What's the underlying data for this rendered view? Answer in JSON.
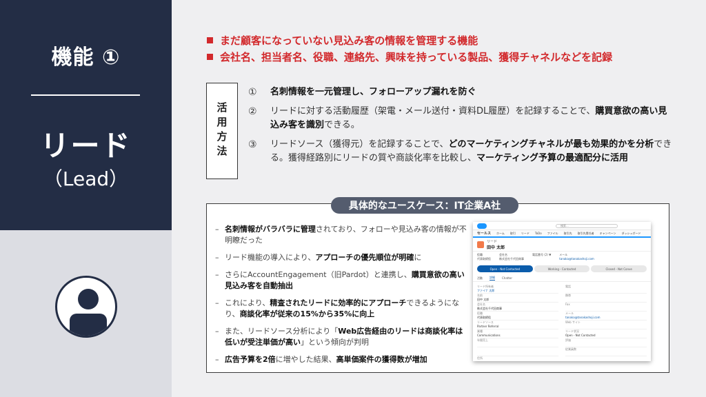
{
  "left": {
    "feature_label": "機能 ①",
    "title_jp": "リード",
    "title_en": "（Lead）"
  },
  "bullets": [
    "まだ顧客になっていない見込み客の情報を管理する機能",
    "会社名、担当者名、役職、連絡先、興味を持っている製品、獲得チャネルなどを記録"
  ],
  "usage": {
    "label": "活用方法",
    "items": [
      {
        "num": "①",
        "parts": [
          {
            "b": "名刺情報を一元管理し、フォローアップ漏れを防ぐ"
          }
        ]
      },
      {
        "num": "②",
        "parts": [
          {
            "t": "リードに対する活動履歴（架電・メール送付・資料DL履歴）を記録することで、"
          },
          {
            "b": "購買意欲の高い見込み客を識別"
          },
          {
            "t": "できる。"
          }
        ]
      },
      {
        "num": "③",
        "parts": [
          {
            "t": "リードソース（獲得元）を記録することで、"
          },
          {
            "b": "どのマーケティングチャネルが最も効果的かを分析"
          },
          {
            "t": "できる。獲得経路別にリードの質や商談化率を比較し、"
          },
          {
            "b": "マーケティング予算の最適配分に活用"
          }
        ]
      }
    ]
  },
  "case": {
    "title": "具体的なユースケース：IT企業A社",
    "items": [
      {
        "parts": [
          {
            "b": "名刺情報がバラバラに管理"
          },
          {
            "t": "されており、フォローや見込み客の情報が不明瞭だった"
          }
        ]
      },
      {
        "parts": [
          {
            "t": "リード機能の導入により、"
          },
          {
            "b": "アプローチの優先順位が明確"
          },
          {
            "t": "に"
          }
        ]
      },
      {
        "parts": [
          {
            "t": "さらにAccountEngagement（旧Pardot）と連携し、"
          },
          {
            "b": "購買意欲の高い見込み客を自動抽出"
          }
        ]
      },
      {
        "parts": [
          {
            "t": "これにより、"
          },
          {
            "b": "精査されたリードに効率的にアプローチ"
          },
          {
            "t": "できるようになり、"
          },
          {
            "b": "商談化率が従来の15%から35%に向上"
          }
        ]
      },
      {
        "parts": [
          {
            "t": "また、リードソース分析により「"
          },
          {
            "b": "Web広告経由のリードは商談化率は低いが受注単価が高い"
          },
          {
            "t": "」という傾向が判明"
          }
        ]
      },
      {
        "parts": [
          {
            "b": "広告予算を2倍"
          },
          {
            "t": "に増やした結果、"
          },
          {
            "b": "高単価案件の獲得数が増加"
          }
        ]
      }
    ]
  },
  "mock": {
    "app": "セールス",
    "nav": [
      "ホーム",
      "取引",
      "リード",
      "ToDo",
      "ファイル",
      "取引先",
      "取引先責任者",
      "キャンペーン",
      "ダッシュボード"
    ],
    "search": "検索...",
    "record_type": "リード",
    "record_name": "田中 太郎",
    "header_fields": [
      {
        "k": "役職",
        "v": "代表取締役"
      },
      {
        "k": "会社名",
        "v": "株式会社千代田商事"
      },
      {
        "k": "電話番号 (2) ▼",
        "v": ""
      },
      {
        "k": "メール",
        "v": "tanaka@tanakashoji.com"
      }
    ],
    "path": [
      "Open - Not Contacted",
      "Working - Contacted",
      "Closed - Not Conve"
    ],
    "tabs": [
      "活動",
      "詳細",
      "Chatter"
    ],
    "left_fields": [
      {
        "k": "リード所有者",
        "v": "ファイナ 太郎",
        "link": true
      },
      {
        "k": "名前",
        "v": "田中 太郎"
      },
      {
        "k": "会社名",
        "v": "株式会社千代田商事"
      },
      {
        "k": "役職",
        "v": "代表取締役"
      },
      {
        "k": "リードソース",
        "v": "Partner Referral"
      },
      {
        "k": "業種",
        "v": "Communications"
      },
      {
        "k": "年間売上",
        "v": ""
      },
      {
        "k": "",
        "v": ""
      },
      {
        "k": "住所",
        "v": ""
      }
    ],
    "right_fields": [
      {
        "k": "電話",
        "v": ""
      },
      {
        "k": "携帯",
        "v": ""
      },
      {
        "k": "Fax",
        "v": ""
      },
      {
        "k": "メール",
        "v": "tanaka@tanakashoji.com",
        "link": true
      },
      {
        "k": "Web サイト",
        "v": ""
      },
      {
        "k": "リード状況",
        "v": "Open - Not Contacted"
      },
      {
        "k": "評価",
        "v": ""
      },
      {
        "k": "従業員数",
        "v": ""
      }
    ]
  },
  "colors": {
    "navy": "#232d45",
    "red": "#d2292c",
    "pill": "#545c6e",
    "sf_blue": "#0b5cab"
  }
}
